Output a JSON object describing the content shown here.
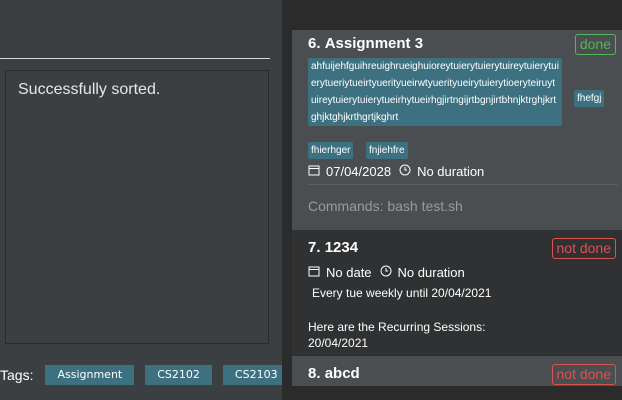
{
  "result": {
    "message": "Successfully sorted."
  },
  "tags": {
    "label": "Tags:",
    "items": [
      "Assignment",
      "CS2102",
      "CS2103"
    ]
  },
  "cards": [
    {
      "index": "6.",
      "title": "Assignment 3",
      "status": "done",
      "long_tag": "ahfuijehfguihreuighrueighuioreytuierytuierytuireytuierytuierytueriytueirtyuerityueirwtyuerityueirytuierytioeryteiruytuireytuierytuierytueirhytueirhgjirtngijrtbgnjirtbhnjktrghjkrtghjktghjkrthgrtjkghrt",
      "tags": [
        "fhefgj",
        "fhierhger",
        "fnjiehfre"
      ],
      "date": "07/04/2028",
      "duration": "No duration",
      "commands": "Commands: bash test.sh"
    },
    {
      "index": "7.",
      "title": "1234",
      "status": "not done",
      "date": "No date",
      "duration": "No duration",
      "recurrence": "Every tue weekly until 20/04/2021",
      "sessions_label": "Here are the Recurring Sessions:",
      "sessions": "20/04/2021"
    },
    {
      "index": "8.",
      "title": "abcd",
      "status": "not done"
    }
  ],
  "icons": {
    "calendar": "calendar-icon",
    "clock": "clock-icon"
  },
  "colors": {
    "tag": "#3d7181",
    "done": "#5ab25a",
    "not_done": "#d9534f"
  }
}
